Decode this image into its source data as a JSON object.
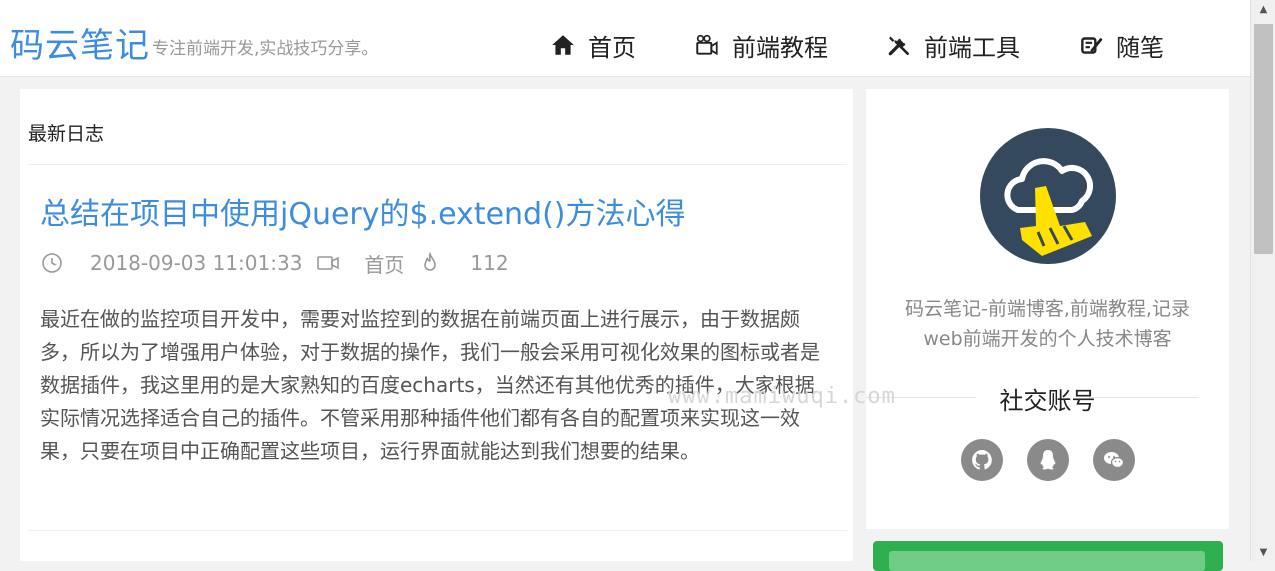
{
  "header": {
    "logo": "码云笔记",
    "slogan": "专注前端开发,实战技巧分享。",
    "nav": [
      {
        "label": "首页",
        "icon": "home-icon"
      },
      {
        "label": "前端教程",
        "icon": "video-camera-icon"
      },
      {
        "label": "前端工具",
        "icon": "tools-icon"
      },
      {
        "label": "随笔",
        "icon": "pen-note-icon"
      }
    ]
  },
  "main": {
    "section_title": "最新日志",
    "post": {
      "title": "总结在项目中使用jQuery的$.extend()方法心得",
      "date": "2018-09-03 11:01:33",
      "category": "首页",
      "views": "112",
      "excerpt": "最近在做的监控项目开发中，需要对监控到的数据在前端页面上进行展示，由于数据颇多，所以为了增强用户体验，对于数据的操作，我们一般会采用可视化效果的图标或者是数据插件，我这里用的是大家熟知的百度echarts，当然还有其他优秀的插件，大家根据实际情况选择适合自己的插件。不管采用那种插件他们都有各自的配置项来实现这一效果，只要在项目中正确配置这些项目，运行界面就能达到我们想要的结果。"
    }
  },
  "sidebar": {
    "description": "码云笔记-前端博客,前端教程,记录web前端开发的个人技术博客",
    "social_title": "社交账号",
    "social": [
      {
        "name": "github",
        "icon": "github-icon"
      },
      {
        "name": "qq",
        "icon": "qq-penguin-icon"
      },
      {
        "name": "wechat",
        "icon": "wechat-icon"
      }
    ]
  },
  "watermark": "www.mamiwuqi.com",
  "colors": {
    "accent": "#3c8dde",
    "avatar_bg": "#34495e",
    "avatar_hand": "#ffe100",
    "social_bg": "#8a8a8a",
    "green_panel": "#2eb050"
  }
}
